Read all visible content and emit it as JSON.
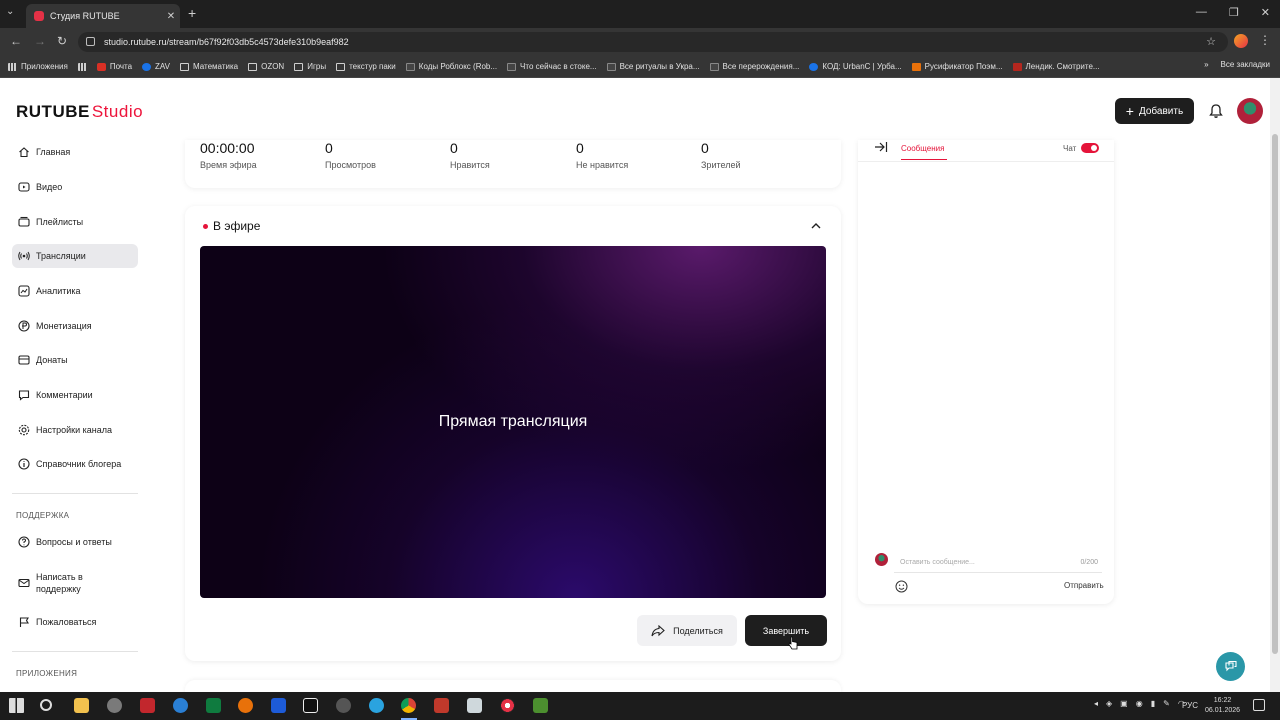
{
  "browser": {
    "tab_title": "Студия RUTUBE",
    "url": "studio.rutube.ru/stream/b67f92f03db5c4573defe310b9eaf982",
    "bookmarks": [
      {
        "label": "Приложения",
        "icon": "grid"
      },
      {
        "label": "",
        "icon": "grid"
      },
      {
        "label": "Почта",
        "icon": "red"
      },
      {
        "label": "ZAV",
        "icon": "blue"
      },
      {
        "label": "Математика",
        "icon": "folder"
      },
      {
        "label": "OZON",
        "icon": "folder"
      },
      {
        "label": "Игры",
        "icon": "folder"
      },
      {
        "label": "текстур паки",
        "icon": "folder"
      },
      {
        "label": "Коды Роблокс (Rob...",
        "icon": "w"
      },
      {
        "label": "Что сейчас в стоке...",
        "icon": "w"
      },
      {
        "label": "Все ритуалы в Укра...",
        "icon": "w"
      },
      {
        "label": "Все перерождения...",
        "icon": "w"
      },
      {
        "label": "КОД: UrbanC | Урба...",
        "icon": "blue"
      },
      {
        "label": "Русификатор Поэм...",
        "icon": "orange"
      },
      {
        "label": "Лендик. Смотрите...",
        "icon": "wine"
      }
    ],
    "bookmarks_more": "»",
    "all_bookmarks": "Все закладки"
  },
  "header": {
    "logo_main": "RUTUBE",
    "logo_studio": "Studio",
    "add_label": "Добавить"
  },
  "sidebar": {
    "items": [
      {
        "label": "Главная",
        "icon": "home-icon"
      },
      {
        "label": "Видео",
        "icon": "video-icon"
      },
      {
        "label": "Плейлисты",
        "icon": "playlist-icon"
      },
      {
        "label": "Трансляции",
        "icon": "broadcast-icon"
      },
      {
        "label": "Аналитика",
        "icon": "analytics-icon"
      },
      {
        "label": "Монетизация",
        "icon": "monetization-icon"
      },
      {
        "label": "Донаты",
        "icon": "donate-icon"
      },
      {
        "label": "Комментарии",
        "icon": "comments-icon"
      },
      {
        "label": "Настройки канала",
        "icon": "settings-icon"
      },
      {
        "label": "Справочник блогера",
        "icon": "info-icon"
      }
    ],
    "support_heading": "ПОДДЕРЖКА",
    "support_items": [
      {
        "label": "Вопросы и ответы",
        "icon": "question-icon"
      },
      {
        "label": "Написать в поддержку",
        "line1": "Написать в",
        "line2": "поддержку",
        "icon": "mail-icon"
      },
      {
        "label": "Пожаловаться",
        "icon": "flag-icon"
      }
    ],
    "apps_heading": "ПРИЛОЖЕНИЯ"
  },
  "stats": [
    {
      "value": "00:00:00",
      "label": "Время эфира"
    },
    {
      "value": "0",
      "label": "Просмотров"
    },
    {
      "value": "0",
      "label": "Нравится"
    },
    {
      "value": "0",
      "label": "Не нравится"
    },
    {
      "value": "0",
      "label": "Зрителей"
    }
  ],
  "live": {
    "title": "В эфире",
    "player_title": "Прямая трансляция",
    "share_label": "Поделиться",
    "finish_label": "Завершить"
  },
  "chat": {
    "tab_messages": "Сообщения",
    "toggle_label": "Чат",
    "toggle_on": true,
    "input_placeholder": "Оставить сообщение...",
    "counter": "0/200",
    "send_label": "Отправить"
  },
  "taskbar": {
    "language": "РУС",
    "time": "16:22",
    "date": "06.01.2026"
  },
  "colors": {
    "accent": "#ed143b",
    "dark_button": "#1e1e1e",
    "help_fab": "#2a97a8"
  }
}
